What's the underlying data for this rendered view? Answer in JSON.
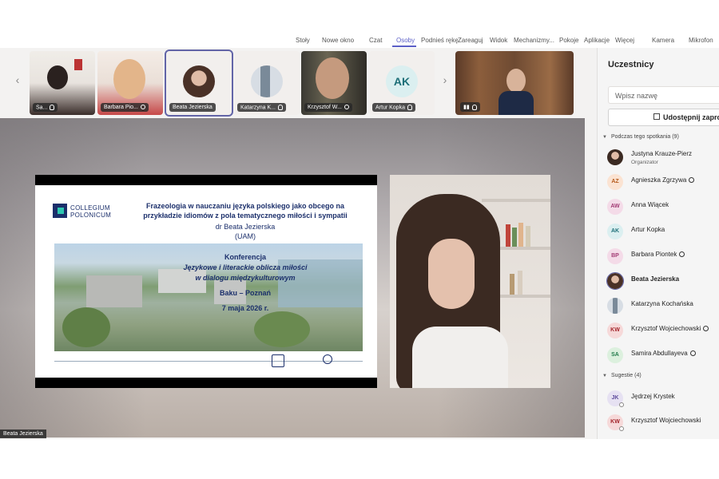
{
  "toolbar": {
    "items": [
      "Stoły",
      "Nowe okno",
      "Czat",
      "Osoby",
      "Podnieś rękę",
      "Zareaguj",
      "Widok",
      "Mechanizmy...",
      "Pokoje",
      "Aplikacje",
      "Więcej",
      "Kamera",
      "Mikrofon"
    ],
    "active": "Osoby"
  },
  "strip": {
    "prev_arrow": "‹",
    "next_arrow": "›",
    "tiles": [
      {
        "name": "Sa...",
        "type": "video"
      },
      {
        "name": "Barbara Pio...",
        "type": "video"
      },
      {
        "name": "Beata Jezierska",
        "type": "photo"
      },
      {
        "name": "Katarzyna K...",
        "type": "photo"
      },
      {
        "name": "Krzysztof W...",
        "type": "video"
      },
      {
        "name": "Artur Kopka",
        "type": "initials",
        "initials": "AK"
      },
      {
        "name": "",
        "type": "video"
      }
    ]
  },
  "slide": {
    "logo_line1": "COLLEGIUM",
    "logo_line2": "POLONICUM",
    "title": "Frazeologia w nauczaniu języka polskiego jako obcego na przykładzie idiomów z pola tematycznego miłości i sympatii",
    "author": "dr Beata Jezierska",
    "affiliation": "(UAM)",
    "conf_label": "Konferencja",
    "conf_title_1": "Językowe i literackie oblicza miłości",
    "conf_title_2": "w dialogu międzykulturowym",
    "place": "Baku – Poznań",
    "date": "7 maja 2026 r."
  },
  "main_video": {
    "speaker_label": "Beata Jezierska"
  },
  "panel": {
    "title": "Uczestnicy",
    "search_placeholder": "Wpisz nazwę",
    "share_label": "Udostępnij zaproszenie",
    "section_meeting": "Podczas tego spotkania (9)",
    "section_suggestions": "Sugestie (4)",
    "participants": [
      {
        "initials": "",
        "name": "Justyna Krauze-Pierz",
        "role": "Organizator",
        "hand": false,
        "bg": "#d9c7b8",
        "fg": "#5a3e2b",
        "photo": true
      },
      {
        "initials": "AZ",
        "name": "Agnieszka Zgrzywa",
        "role": "",
        "hand": true,
        "bg": "#fbe3d2",
        "fg": "#b55a1b",
        "photo": false
      },
      {
        "initials": "AW",
        "name": "Anna Wiącek",
        "role": "",
        "hand": false,
        "bg": "#f4dbe8",
        "fg": "#a33c75",
        "photo": false
      },
      {
        "initials": "AK",
        "name": "Artur Kopka",
        "role": "",
        "hand": false,
        "bg": "#dbeff0",
        "fg": "#1d6f78",
        "photo": false
      },
      {
        "initials": "BP",
        "name": "Barbara Piontek",
        "role": "",
        "hand": true,
        "bg": "#f4dbe8",
        "fg": "#a33c75",
        "photo": false
      },
      {
        "initials": "",
        "name": "Beata Jezierska",
        "role": "",
        "hand": false,
        "bg": "#e9ddd5",
        "fg": "#5a3e2b",
        "photo": true,
        "bold": true
      },
      {
        "initials": "",
        "name": "Katarzyna Kochańska",
        "role": "",
        "hand": false,
        "bg": "#cfd6de",
        "fg": "#333",
        "photo": true
      },
      {
        "initials": "KW",
        "name": "Krzysztof Wojciechowski",
        "role": "",
        "hand": true,
        "bg": "#f6d9d9",
        "fg": "#a4262c",
        "photo": false
      },
      {
        "initials": "SA",
        "name": "Samira Abdullayeva",
        "role": "",
        "hand": true,
        "bg": "#dcf0de",
        "fg": "#237b4b",
        "photo": false
      }
    ],
    "suggestions": [
      {
        "initials": "JK",
        "name": "Jędrzej Krystek",
        "bg": "#e6e1f2",
        "fg": "#5c4a9b"
      },
      {
        "initials": "KW",
        "name": "Krzysztof Wojciechowski",
        "bg": "#f6d9d9",
        "fg": "#a4262c"
      }
    ]
  }
}
